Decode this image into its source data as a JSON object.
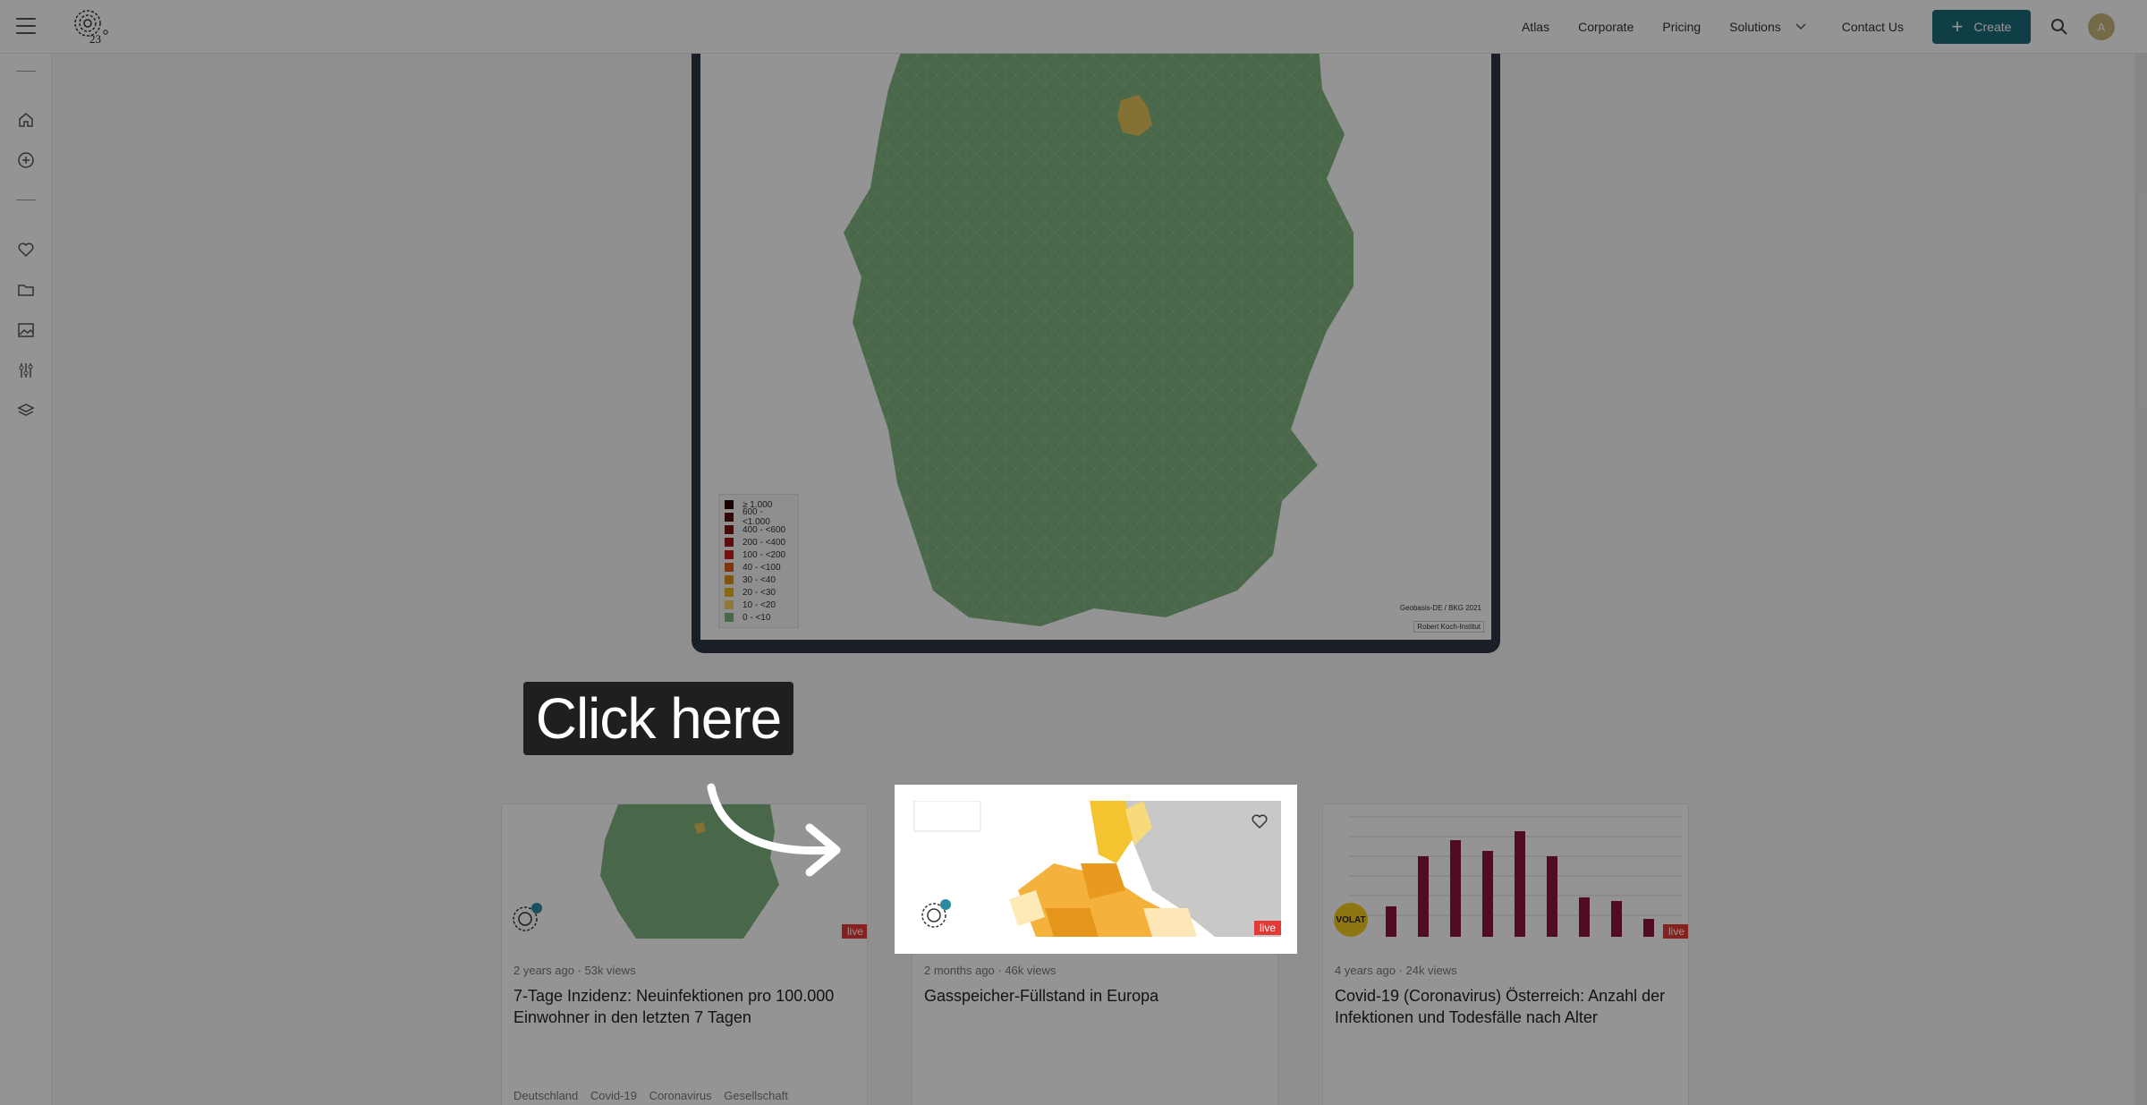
{
  "nav": {
    "links": [
      "Atlas",
      "Corporate",
      "Pricing"
    ],
    "solutions_label": "Solutions",
    "contact_label": "Contact Us",
    "create_label": "Create",
    "avatar_initial": "A"
  },
  "sidebar": {
    "icons": [
      "home-icon",
      "add-circle-icon",
      "heart-icon",
      "folder-icon",
      "image-icon",
      "sliders-icon",
      "layers-icon"
    ]
  },
  "map": {
    "legend": [
      {
        "label": "≥ 1.000",
        "color": "#2b0a0a"
      },
      {
        "label": "600 - <1.000",
        "color": "#5a0f0f"
      },
      {
        "label": "400 - <600",
        "color": "#7e1212"
      },
      {
        "label": "200 - <400",
        "color": "#a51616"
      },
      {
        "label": "100 - <200",
        "color": "#c91f1f"
      },
      {
        "label": "40 - <100",
        "color": "#d85a1a"
      },
      {
        "label": "30 - <40",
        "color": "#e2911a"
      },
      {
        "label": "20 - <30",
        "color": "#ebb31c"
      },
      {
        "label": "10 - <20",
        "color": "#f1d067"
      },
      {
        "label": "0 - <10",
        "color": "#7fb27f"
      }
    ],
    "credit_1": "Geobasis-DE / BKG 2021",
    "credit_2": "Robert Koch-Institut"
  },
  "tooltip": {
    "text": "Click here"
  },
  "cards": [
    {
      "meta": "2 years ago · 53k views",
      "title": "7-Tage Inzidenz: Neuinfektionen pro 100.000 Einwohner in den letzten 7 Tagen",
      "tags": [
        "Deutschland",
        "Covid-19",
        "Coronavirus",
        "Gesellschaft"
      ],
      "live": "live"
    },
    {
      "meta": "2 months ago · 46k views",
      "title": "Gasspeicher-Füllstand in Europa",
      "live": "live"
    },
    {
      "meta": "4 years ago · 24k views",
      "title": "Covid-19 (Coronavirus) Österreich: Anzahl der Infektionen und Todesfälle nach Alter",
      "live": "live",
      "badge": "VOLAT"
    }
  ],
  "colors": {
    "accent": "#1d6b7a",
    "map_green": "#7fb27f",
    "bar_red": "#8b1538",
    "live_red": "#e53935"
  }
}
